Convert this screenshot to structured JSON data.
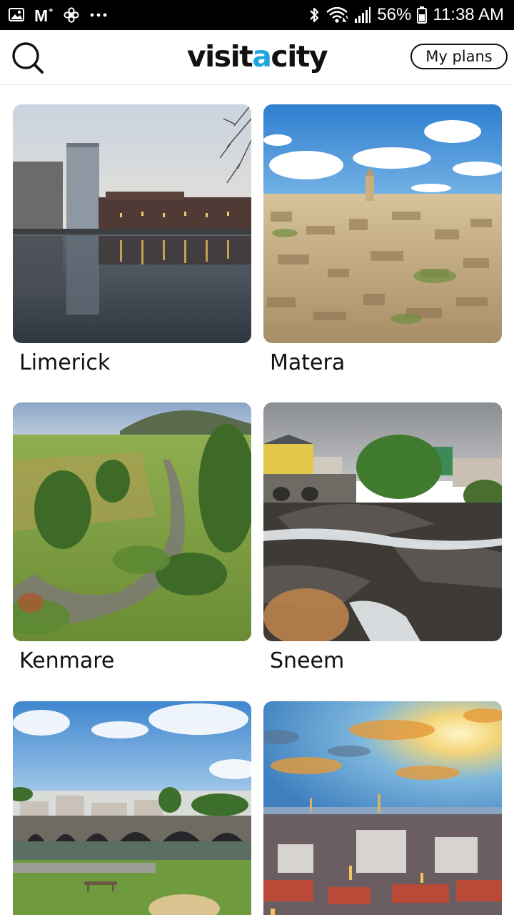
{
  "status_bar": {
    "left_icons": [
      "gallery-notification-icon",
      "gmail-notification-icon",
      "pinwheel-notification-icon",
      "more-notifications-icon"
    ],
    "right_icons": [
      "bluetooth-icon",
      "wifi-icon",
      "signal-icon",
      "battery-icon"
    ],
    "battery": "56%",
    "time": "11:38 AM"
  },
  "header": {
    "search_icon": "search-icon",
    "logo_prefix": "visit",
    "logo_accent": "a",
    "logo_suffix": "city",
    "my_plans_label": "My plans"
  },
  "colors": {
    "accent": "#1fa5e0",
    "text": "#111111",
    "status_bar_bg": "#000000"
  },
  "cities": [
    {
      "name": "Limerick"
    },
    {
      "name": "Matera"
    },
    {
      "name": "Kenmare"
    },
    {
      "name": "Sneem"
    },
    {
      "name": ""
    },
    {
      "name": ""
    }
  ]
}
